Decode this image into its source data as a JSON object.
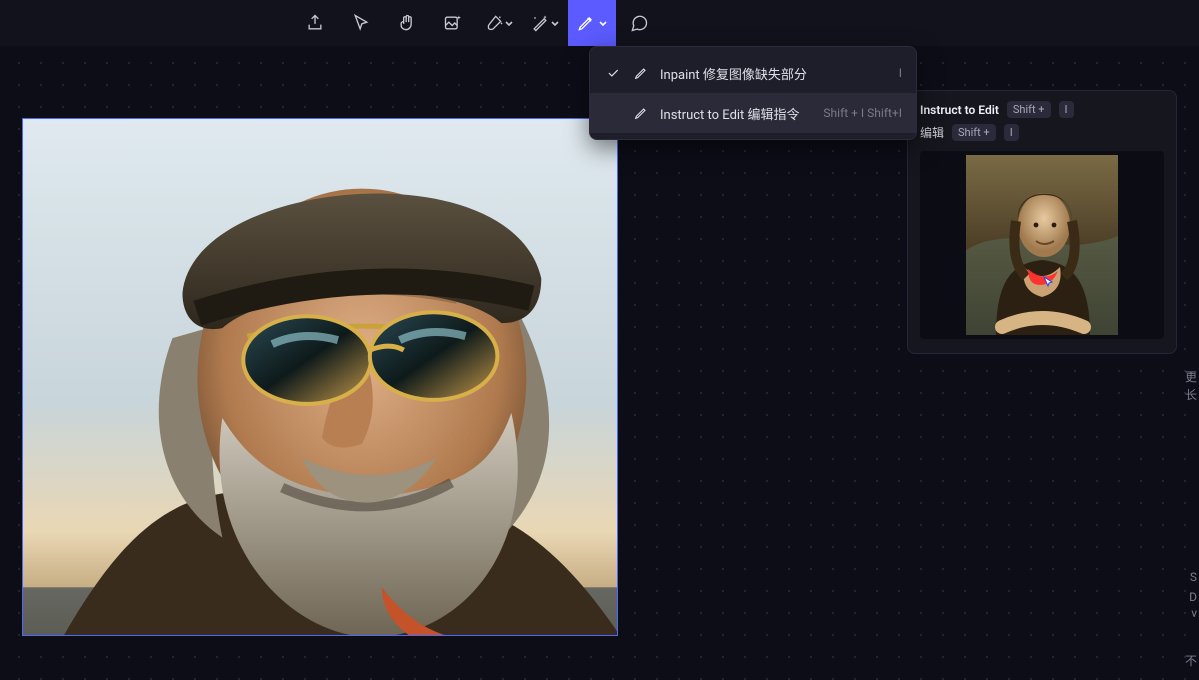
{
  "toolbar": {
    "tools": [
      {
        "name": "export-icon"
      },
      {
        "name": "cursor-icon"
      },
      {
        "name": "hand-icon"
      },
      {
        "name": "image-sparkle-icon"
      },
      {
        "name": "brush-sparkle-icon"
      },
      {
        "name": "wand-sparkle-icon"
      },
      {
        "name": "pen-icon",
        "active": true
      },
      {
        "name": "comment-icon"
      }
    ]
  },
  "dropdown": {
    "items": [
      {
        "checked": true,
        "label": "Inpaint 修复图像缺失部分",
        "shortcut": "I"
      },
      {
        "checked": false,
        "label": "Instruct to Edit 编辑指令",
        "shortcut": "Shift + I Shift+I",
        "highlight": true
      }
    ]
  },
  "panel": {
    "title": "Instruct to Edit",
    "title_kb1": "Shift +",
    "title_kb2": "I",
    "row2_label": "编辑",
    "row2_kb1": "Shift +",
    "row2_kb2": "I"
  },
  "edge_chars": {
    "a": "更",
    "b": "长",
    "c": "S",
    "d": "D",
    "e": "v",
    "f": "不"
  }
}
